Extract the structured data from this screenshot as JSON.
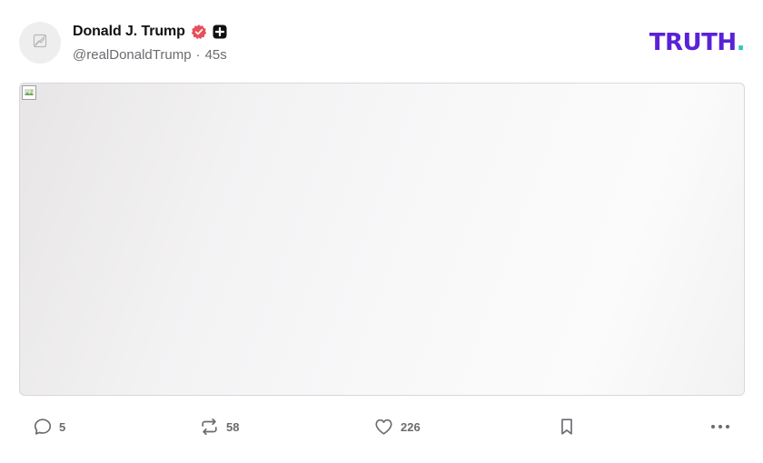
{
  "post": {
    "author_name": "Donald J. Trump",
    "handle": "@realDonaldTrump",
    "separator": "·",
    "time": "45s",
    "verified_badge_icon": "verified-check-icon",
    "plus_badge_icon": "plus-square-icon",
    "avatar_icon": "broken-image-icon"
  },
  "brand": {
    "logo_text": "TRUTH",
    "logo_dot": ".",
    "logo_color": "#5b21d6",
    "logo_dot_color": "#2ac7c2"
  },
  "media": {
    "icon": "broken-image-icon"
  },
  "actions": {
    "reply_count": "5",
    "repost_count": "58",
    "like_count": "226",
    "reply_icon": "comment-bubble-icon",
    "repost_icon": "repost-icon",
    "like_icon": "heart-icon",
    "bookmark_icon": "bookmark-icon",
    "more_icon": "more-horizontal-icon"
  },
  "colors": {
    "badge": "#e8505b",
    "muted_text": "#6b6b70",
    "border": "#d8d8dc"
  }
}
